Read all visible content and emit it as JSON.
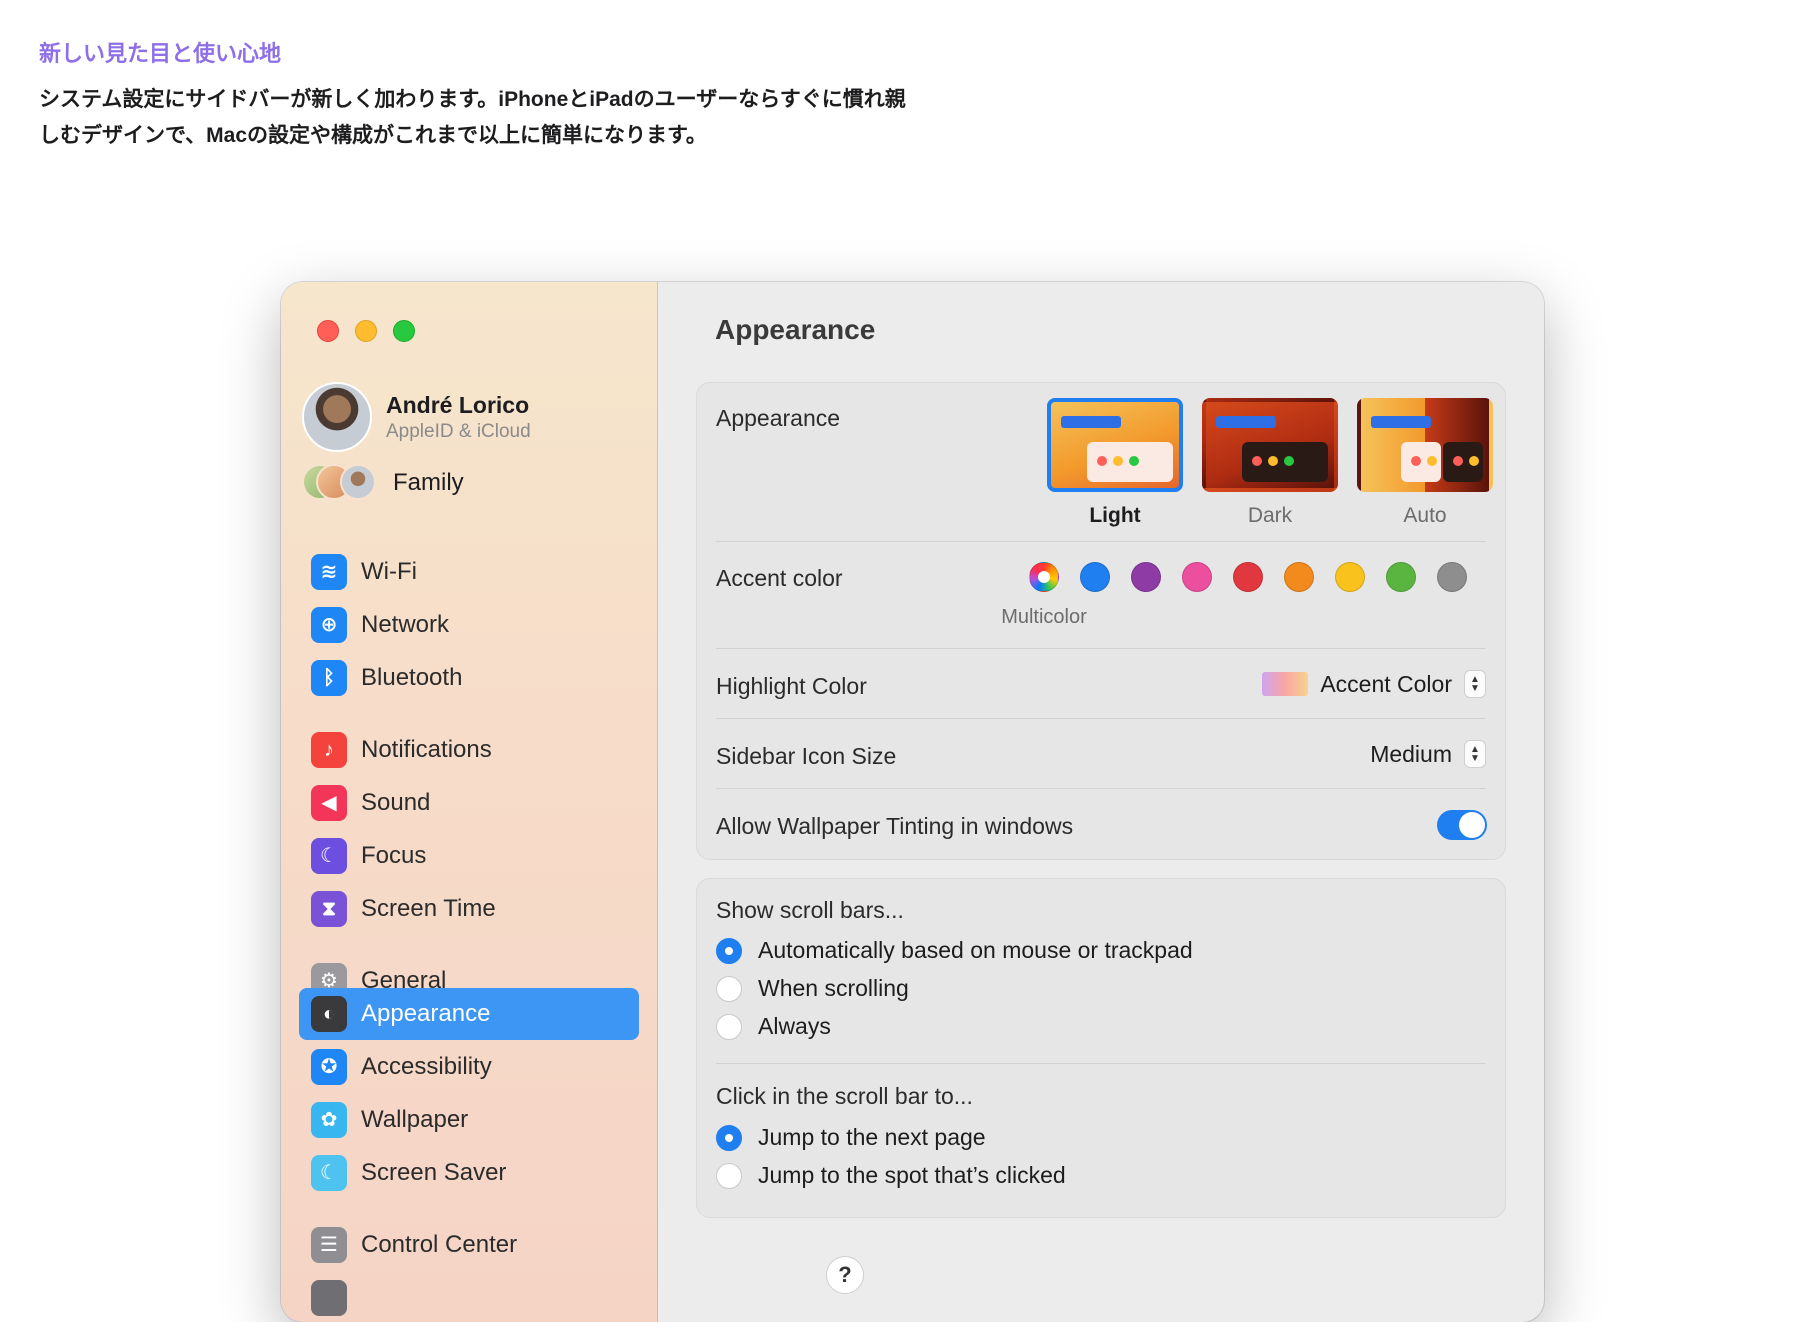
{
  "intro": {
    "headline": "新しい見た目と使い心地",
    "line1": "システム設定にサイドバーが新しく加わります。iPhoneとiPadのユーザーならすぐに慣れ親",
    "line2": "しむデザインで、Macの設定や構成がこれまで以上に簡単になります。"
  },
  "profile": {
    "name": "André Lorico",
    "subtitle": "AppleID & iCloud"
  },
  "family": {
    "label": "Family"
  },
  "sidebar": {
    "items": [
      {
        "label": "Wi-Fi",
        "icon": "wifi-icon",
        "color": "#1f87f5",
        "glyph": "≋"
      },
      {
        "label": "Network",
        "icon": "globe-icon",
        "color": "#1f87f5",
        "glyph": "⊕"
      },
      {
        "label": "Bluetooth",
        "icon": "bluetooth-icon",
        "color": "#1f87f5",
        "glyph": "ᛒ"
      },
      {
        "label": "Notifications",
        "icon": "bell-icon",
        "color": "#f4433c",
        "glyph": "♪"
      },
      {
        "label": "Sound",
        "icon": "speaker-icon",
        "color": "#f23558",
        "glyph": "◀"
      },
      {
        "label": "Focus",
        "icon": "moon-icon",
        "color": "#6c4ee0",
        "glyph": "☾"
      },
      {
        "label": "Screen Time",
        "icon": "hourglass-icon",
        "color": "#7a52d8",
        "glyph": "⧗"
      },
      {
        "label": "General",
        "icon": "gear-icon",
        "color": "#9a9a9e",
        "glyph": "⚙"
      },
      {
        "label": "Appearance",
        "icon": "appearance-icon",
        "color": "#3a3a3c",
        "glyph": "◐"
      },
      {
        "label": "Accessibility",
        "icon": "accessibility-icon",
        "color": "#1f87f5",
        "glyph": "✪"
      },
      {
        "label": "Wallpaper",
        "icon": "flower-icon",
        "color": "#38b6f0",
        "glyph": "✿"
      },
      {
        "label": "Screen Saver",
        "icon": "screensaver-icon",
        "color": "#4ec3f0",
        "glyph": "☾"
      },
      {
        "label": "Control Center",
        "icon": "toggles-icon",
        "color": "#8e8e93",
        "glyph": "☰"
      }
    ],
    "selected": "Appearance"
  },
  "content": {
    "title": "Appearance",
    "appearance_label": "Appearance",
    "themes": [
      {
        "label": "Light",
        "selected": true
      },
      {
        "label": "Dark",
        "selected": false
      },
      {
        "label": "Auto",
        "selected": false
      }
    ],
    "accent_label": "Accent color",
    "accent_colors": [
      "multicolor",
      "#1f7ff0",
      "#8e3ba6",
      "#ec4f9e",
      "#e0383e",
      "#f38a1e",
      "#f9c21c",
      "#5ab540",
      "#8e8e8e"
    ],
    "accent_selected_label": "Multicolor",
    "highlight_label": "Highlight Color",
    "highlight_value": "Accent Color",
    "icon_size_label": "Sidebar Icon Size",
    "icon_size_value": "Medium",
    "tinting_label": "Allow Wallpaper Tinting in windows",
    "tinting_on": true,
    "scroll_heading": "Show scroll bars...",
    "scroll_options": [
      {
        "label": "Automatically based on mouse or trackpad",
        "checked": true
      },
      {
        "label": "When scrolling",
        "checked": false
      },
      {
        "label": "Always",
        "checked": false
      }
    ],
    "click_heading": "Click in the scroll bar to...",
    "click_options": [
      {
        "label": "Jump to the next page",
        "checked": true
      },
      {
        "label": "Jump to the spot that’s clicked",
        "checked": false
      }
    ],
    "help_label": "?"
  }
}
